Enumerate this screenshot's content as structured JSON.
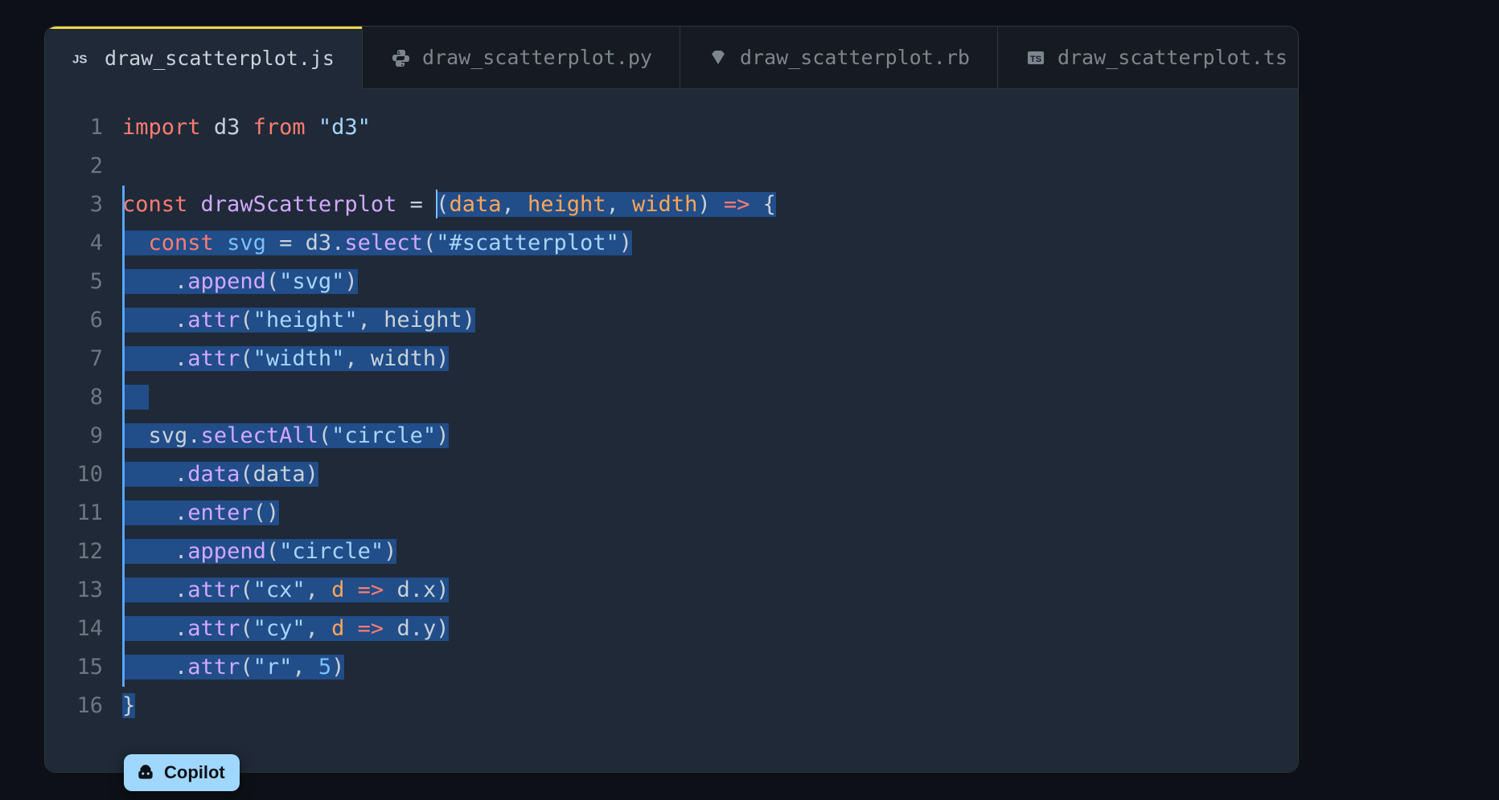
{
  "tabs": [
    {
      "icon": "js",
      "label": "draw_scatterplot.js",
      "active": true
    },
    {
      "icon": "python",
      "label": "draw_scatterplot.py",
      "active": false
    },
    {
      "icon": "ruby",
      "label": "draw_scatterplot.rb",
      "active": false
    },
    {
      "icon": "ts",
      "label": "draw_scatterplot.ts",
      "active": false
    }
  ],
  "copilot_label": "Copilot",
  "line_numbers": [
    "1",
    "2",
    "3",
    "4",
    "5",
    "6",
    "7",
    "8",
    "9",
    "10",
    "11",
    "12",
    "13",
    "14",
    "15",
    "16"
  ],
  "code": {
    "l1": {
      "import": "import",
      "d3": "d3",
      "from": "from",
      "str": "\"d3\""
    },
    "l3": {
      "const": "const",
      "name": "drawScatterplot",
      "eq": " = ",
      "sel": "(data, height, width) => {"
    },
    "l4": {
      "pad": "  ",
      "const": "const",
      "svg": "svg",
      "eq": " = ",
      "d3": "d3",
      "dot": ".",
      "select": "select",
      "open": "(",
      "str": "\"#scatterplot\"",
      "close": ")"
    },
    "l5": {
      "pad": "    ",
      "dot": ".",
      "append": "append",
      "open": "(",
      "str": "\"svg\"",
      "close": ")"
    },
    "l6": {
      "pad": "    ",
      "dot": ".",
      "attr": "attr",
      "open": "(",
      "str": "\"height\"",
      "comma": ", ",
      "arg": "height",
      "close": ")"
    },
    "l7": {
      "pad": "    ",
      "dot": ".",
      "attr": "attr",
      "open": "(",
      "str": "\"width\"",
      "comma": ", ",
      "arg": "width",
      "close": ")"
    },
    "l9": {
      "pad": "  ",
      "svg": "svg",
      "dot": ".",
      "selectAll": "selectAll",
      "open": "(",
      "str": "\"circle\"",
      "close": ")"
    },
    "l10": {
      "pad": "    ",
      "dot": ".",
      "data": "data",
      "open": "(",
      "arg": "data",
      "close": ")"
    },
    "l11": {
      "pad": "    ",
      "dot": ".",
      "enter": "enter",
      "open": "(",
      "close": ")"
    },
    "l12": {
      "pad": "    ",
      "dot": ".",
      "append": "append",
      "open": "(",
      "str": "\"circle\"",
      "close": ")"
    },
    "l13": {
      "pad": "    ",
      "dot": ".",
      "attr": "attr",
      "open": "(",
      "str": "\"cx\"",
      "comma": ", ",
      "p": "d",
      "arrow": " => ",
      "expr": "d.x",
      "close": ")"
    },
    "l14": {
      "pad": "    ",
      "dot": ".",
      "attr": "attr",
      "open": "(",
      "str": "\"cy\"",
      "comma": ", ",
      "p": "d",
      "arrow": " => ",
      "expr": "d.y",
      "close": ")"
    },
    "l15": {
      "pad": "    ",
      "dot": ".",
      "attr": "attr",
      "open": "(",
      "str": "\"r\"",
      "comma": ", ",
      "num": "5",
      "close": ")"
    },
    "l16": {
      "brace": "}"
    }
  }
}
